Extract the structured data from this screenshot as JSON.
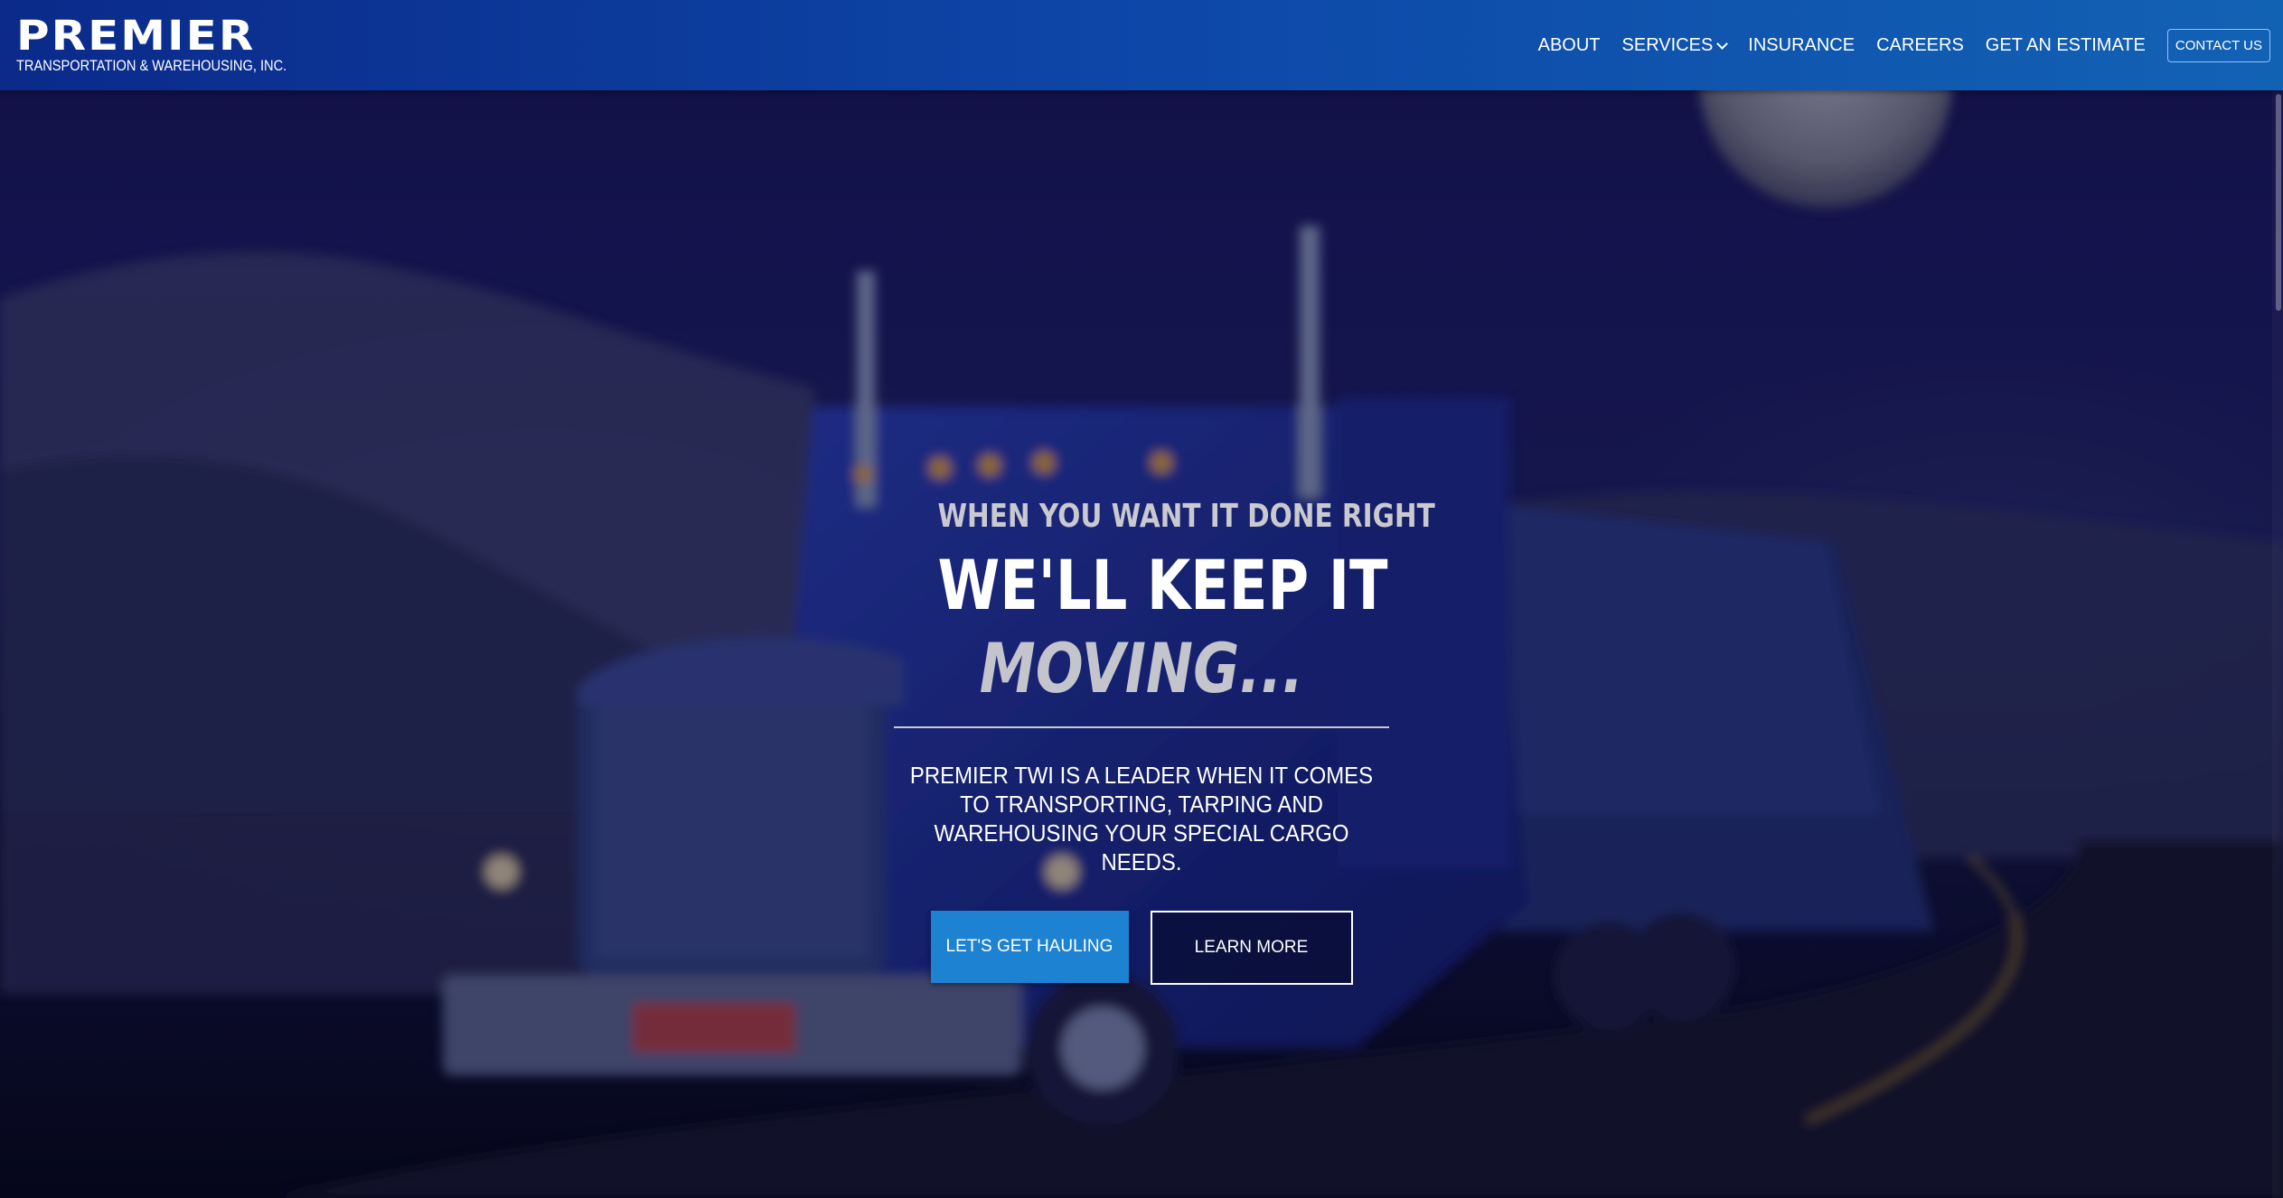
{
  "header": {
    "logo": {
      "name": "PREMIER",
      "subtitle": "TRANSPORTATION & WAREHOUSING, INC."
    },
    "nav": {
      "items": [
        {
          "label": "ABOUT"
        },
        {
          "label": "SERVICES",
          "icon": "chevron-down-icon"
        },
        {
          "label": "INSURANCE"
        },
        {
          "label": "CAREERS"
        },
        {
          "label": "GET AN ESTIMATE"
        }
      ],
      "contact_label": "CONTACT US"
    }
  },
  "hero": {
    "eyebrow": "WHEN YOU WANT IT DONE RIGHT",
    "headline_line1": "WE'LL KEEP IT",
    "headline_line2": "MOVING...",
    "tagline": "PREMIER TWI IS A LEADER WHEN IT COMES TO TRANSPORTING, TARPING AND WAREHOUSING YOUR SPECIAL CARGO NEEDS.",
    "primary_cta": "LET'S GET HAULING",
    "secondary_cta": "LEARN MORE"
  },
  "colors": {
    "header_start": "#0b2a8a",
    "header_end": "#1262b4",
    "primary_button": "#1e82d2",
    "hero_overlay": "#17154f"
  }
}
